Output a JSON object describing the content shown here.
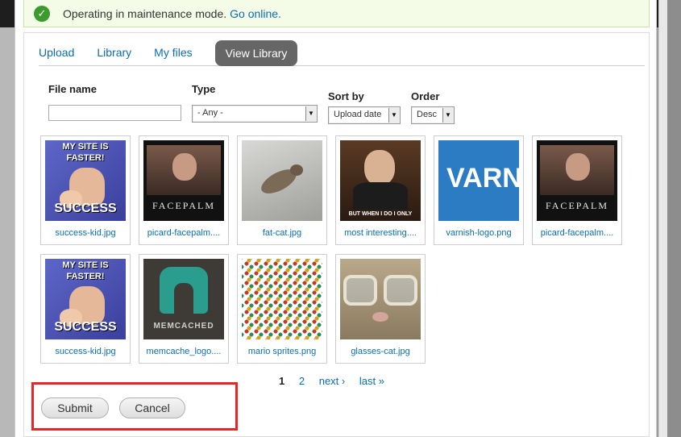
{
  "status": {
    "message": "Operating in maintenance mode.",
    "link": "Go online."
  },
  "tabs": [
    "Upload",
    "Library",
    "My files",
    "View Library"
  ],
  "filters": {
    "file_name_label": "File name",
    "type_label": "Type",
    "type_value": "- Any -",
    "sort_label": "Sort by",
    "sort_value": "Upload date",
    "order_label": "Order",
    "order_value": "Desc"
  },
  "files": [
    {
      "name": "success-kid.jpg"
    },
    {
      "name": "picard-facepalm...."
    },
    {
      "name": "fat-cat.jpg"
    },
    {
      "name": "most interesting...."
    },
    {
      "name": "varnish-logo.png"
    },
    {
      "name": "picard-facepalm...."
    },
    {
      "name": "success-kid.jpg"
    },
    {
      "name": "memcache_logo...."
    },
    {
      "name": "mario sprites.png"
    },
    {
      "name": "glasses-cat.jpg"
    }
  ],
  "image_text": {
    "success_top": "MY SITE IS",
    "success_mid": "FASTER!",
    "success_bottom": "SUCCESS",
    "facepalm": "FACEPALM",
    "interesting_bottom": "BUT WHEN I DO I ONLY",
    "varnish": "VARN",
    "memcached": "MEMCACHED"
  },
  "pager": {
    "pages": [
      "1",
      "2"
    ],
    "next": "next ›",
    "last": "last »"
  },
  "buttons": {
    "submit": "Submit",
    "cancel": "Cancel"
  },
  "colors": {
    "link": "#0a6db0",
    "active_tab": "#666666",
    "highlight": "#e8262a",
    "status_bg": "#f4fbe6",
    "check": "#3d9a2f"
  }
}
